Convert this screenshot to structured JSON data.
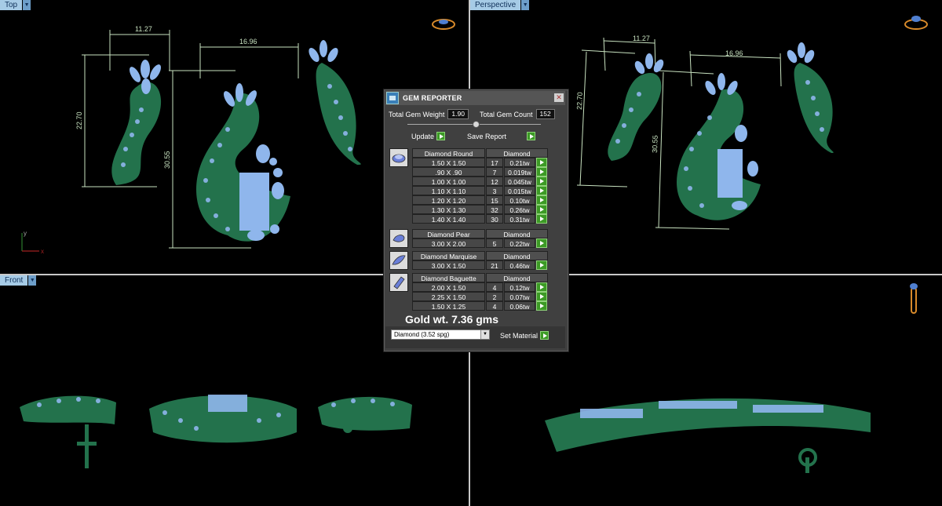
{
  "viewports": {
    "top_left": {
      "name": "Top"
    },
    "top_right": {
      "name": "Perspective"
    },
    "bottom_left": {
      "name": "Front"
    },
    "bottom_right": {
      "name": ""
    }
  },
  "dimensions": {
    "top_left": [
      "11.27",
      "16.96",
      "22.70",
      "30.55"
    ],
    "top_right": [
      "11.27",
      "16.96",
      "22.70",
      "30.55"
    ]
  },
  "axes": {
    "y": "y",
    "x": "x"
  },
  "gem_reporter": {
    "title": "GEM REPORTER",
    "total_weight_label": "Total Gem Weight",
    "total_weight_value": "1.90",
    "total_count_label": "Total Gem Count",
    "total_count_value": "152",
    "update_label": "Update",
    "save_label": "Save Report",
    "groups": [
      {
        "name": "Diamond Round",
        "material": "Diamond",
        "icon": "round-gem-icon",
        "rows": [
          {
            "size": "1.50 X 1.50",
            "count": "17",
            "weight": "0.21tw"
          },
          {
            "size": ".90 X .90",
            "count": "7",
            "weight": "0.019tw"
          },
          {
            "size": "1.00 X 1.00",
            "count": "12",
            "weight": "0.045tw"
          },
          {
            "size": "1.10 X 1.10",
            "count": "3",
            "weight": "0.015tw"
          },
          {
            "size": "1.20 X 1.20",
            "count": "15",
            "weight": "0.10tw"
          },
          {
            "size": "1.30 X 1.30",
            "count": "32",
            "weight": "0.26tw"
          },
          {
            "size": "1.40 X 1.40",
            "count": "30",
            "weight": "0.31tw"
          }
        ]
      },
      {
        "name": "Diamond Pear",
        "material": "Diamond",
        "icon": "pear-gem-icon",
        "rows": [
          {
            "size": "3.00 X 2.00",
            "count": "5",
            "weight": "0.22tw"
          }
        ]
      },
      {
        "name": "Diamond Marquise",
        "material": "Diamond",
        "icon": "marquise-gem-icon",
        "rows": [
          {
            "size": "3.00 X 1.50",
            "count": "21",
            "weight": "0.46tw"
          }
        ]
      },
      {
        "name": "Diamond Baguette",
        "material": "Diamond",
        "icon": "baguette-gem-icon",
        "rows": [
          {
            "size": "2.00 X 1.50",
            "count": "4",
            "weight": "0.12tw"
          },
          {
            "size": "2.25 X 1.50",
            "count": "2",
            "weight": "0.07tw"
          },
          {
            "size": "1.50 X 1.25",
            "count": "4",
            "weight": "0.06tw"
          }
        ]
      }
    ],
    "gold_text": "Gold wt. 7.36 gms",
    "material_select": "Diamond     (3.52 spg)",
    "set_material_label": "Set Material"
  },
  "colors": {
    "metal": "#23724c",
    "gem": "#8fb6ec",
    "dimension": "#c8e2c0",
    "label_bg": "#a6cbe6"
  }
}
